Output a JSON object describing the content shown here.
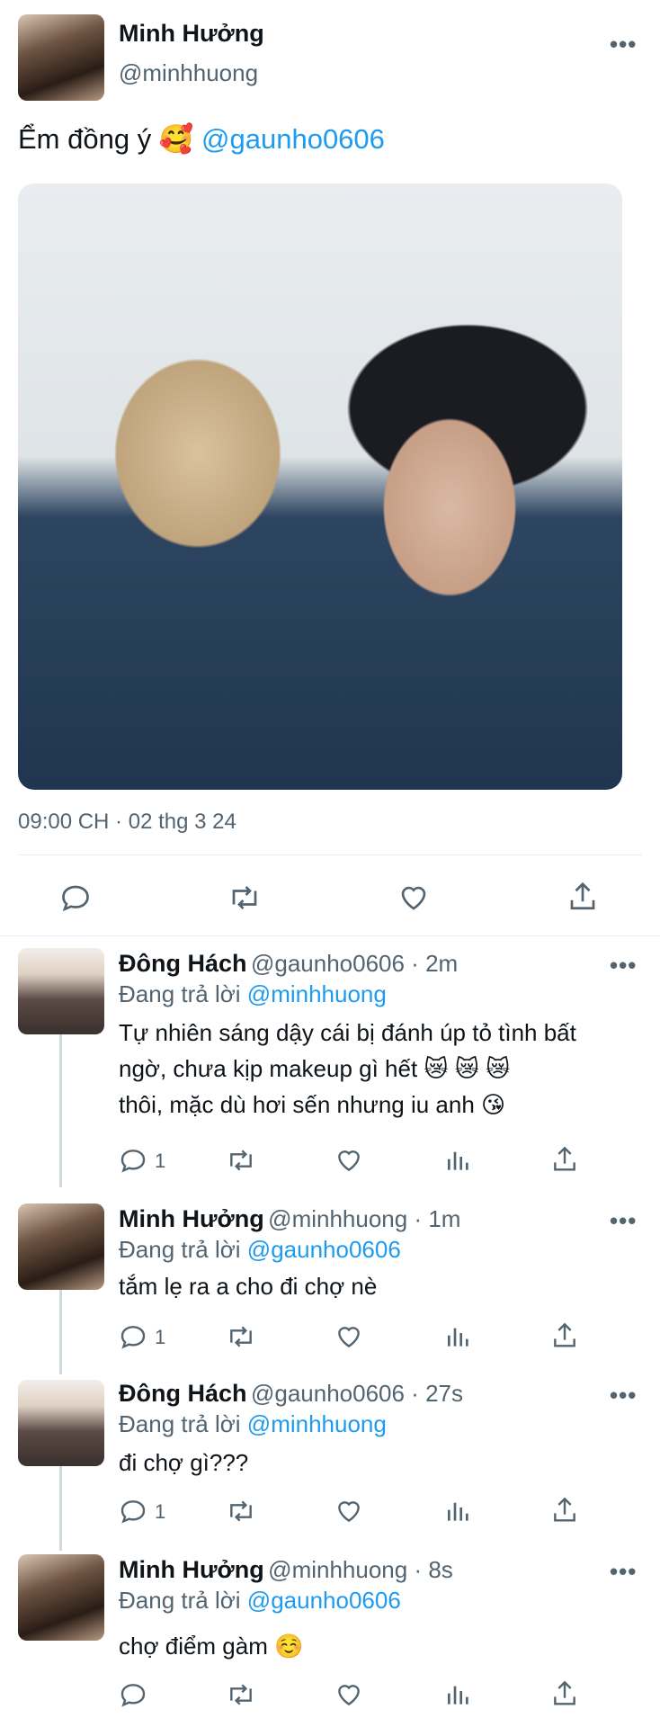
{
  "main_tweet": {
    "author_name": "Minh Hưởng",
    "author_handle": "@minhhuong",
    "text": "Ểm đồng ý 🥰",
    "mention": "@gaunho0606",
    "timestamp": "09:00 CH · 02 thg 3 24"
  },
  "more_glyph": "•••",
  "replies": [
    {
      "author_name": "Đông Hách",
      "meta": "@gaunho0606 · 2m",
      "replying_prefix": "Đang trả lời",
      "replying_to": "@minhhuong",
      "lines": [
        "Tự nhiên sáng dậy cái bị đánh úp tỏ tình bất",
        "ngờ, chưa kịp makeup gì hết 😿 😿 😿",
        "thôi, mặc dù hơi sến nhưng iu anh 😘"
      ],
      "reply_count": "1"
    },
    {
      "author_name": "Minh Hưởng",
      "meta": "@minhhuong · 1m",
      "replying_prefix": "Đang trả lời",
      "replying_to": "@gaunho0606",
      "lines": [
        "tắm lẹ ra a cho đi chợ nè"
      ],
      "reply_count": "1"
    },
    {
      "author_name": "Đông Hách",
      "meta": "@gaunho0606 · 27s",
      "replying_prefix": "Đang trả lời",
      "replying_to": "@minhhuong",
      "lines": [
        "đi chợ gì???"
      ],
      "reply_count": "1"
    },
    {
      "author_name": "Minh Hưởng",
      "meta": "@minhhuong · 8s",
      "replying_prefix": "Đang trả lời",
      "replying_to": "@gaunho0606",
      "lines": [
        "chợ điểm gàm ☺️"
      ],
      "reply_count": ""
    }
  ],
  "colors": {
    "link": "#1d9bf0",
    "secondary_text": "#536471",
    "divider": "#e6ecf0"
  },
  "icons": [
    "reply-icon",
    "retweet-icon",
    "like-icon",
    "share-icon",
    "analytics-icon",
    "more-icon"
  ]
}
